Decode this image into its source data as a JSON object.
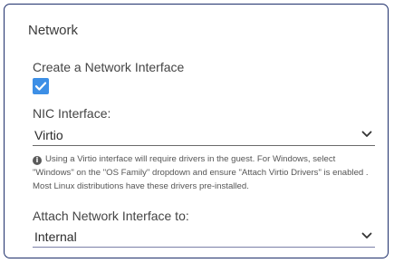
{
  "section": {
    "title": "Network"
  },
  "create_interface": {
    "label": "Create a Network Interface",
    "checked": true
  },
  "nic": {
    "label": "NIC Interface:",
    "value": "Virtio",
    "note": "Using a Virtio interface will require drivers in the guest. For Windows, select \"Windows\" on the \"OS Family\" dropdown and ensure \"Attach Virtio Drivers\" is enabled . Most Linux distributions have these drivers pre-installed."
  },
  "attach": {
    "label": "Attach Network Interface to:",
    "value": "Internal"
  },
  "colors": {
    "checkbox": "#3d8fe6",
    "frame_border": "#1e2f6b"
  },
  "icons": {
    "check": "check-icon",
    "chevron": "chevron-down-icon",
    "info": "info-icon"
  }
}
